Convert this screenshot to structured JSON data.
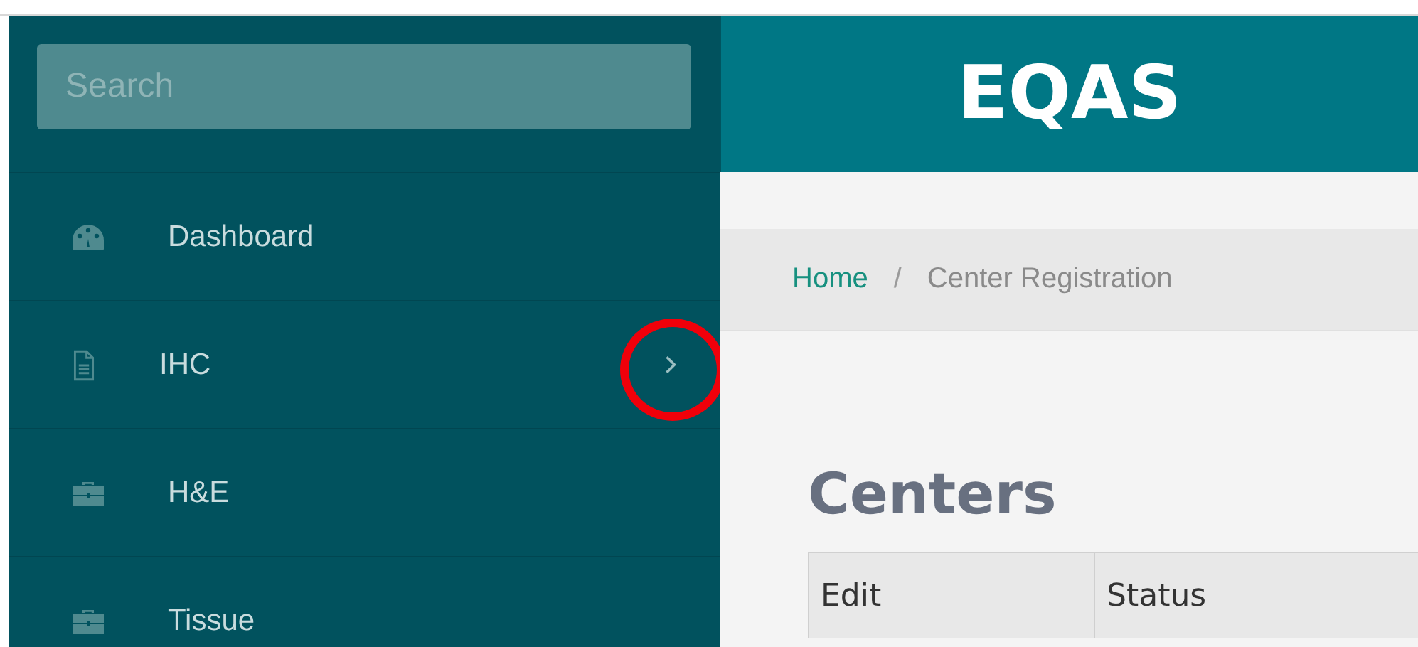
{
  "sidebar": {
    "search": {
      "placeholder": "Search"
    },
    "items": [
      {
        "label": "Dashboard",
        "kind": "dashboard",
        "expandable": false,
        "highlighted": false
      },
      {
        "label": "IHC",
        "kind": "document",
        "expandable": true,
        "highlighted": true
      },
      {
        "label": "H&E",
        "kind": "case",
        "expandable": false,
        "highlighted": false
      },
      {
        "label": "Tissue",
        "kind": "case",
        "expandable": false,
        "highlighted": false
      }
    ]
  },
  "header": {
    "title": "EQAS"
  },
  "breadcrumb": [
    {
      "label": "Home",
      "kind": "link"
    },
    {
      "label": "/",
      "kind": "separator"
    },
    {
      "label": "Center Registration",
      "kind": "current"
    }
  ],
  "page_title": "Centers",
  "table": {
    "columns": [
      "Edit",
      "Status"
    ]
  }
}
